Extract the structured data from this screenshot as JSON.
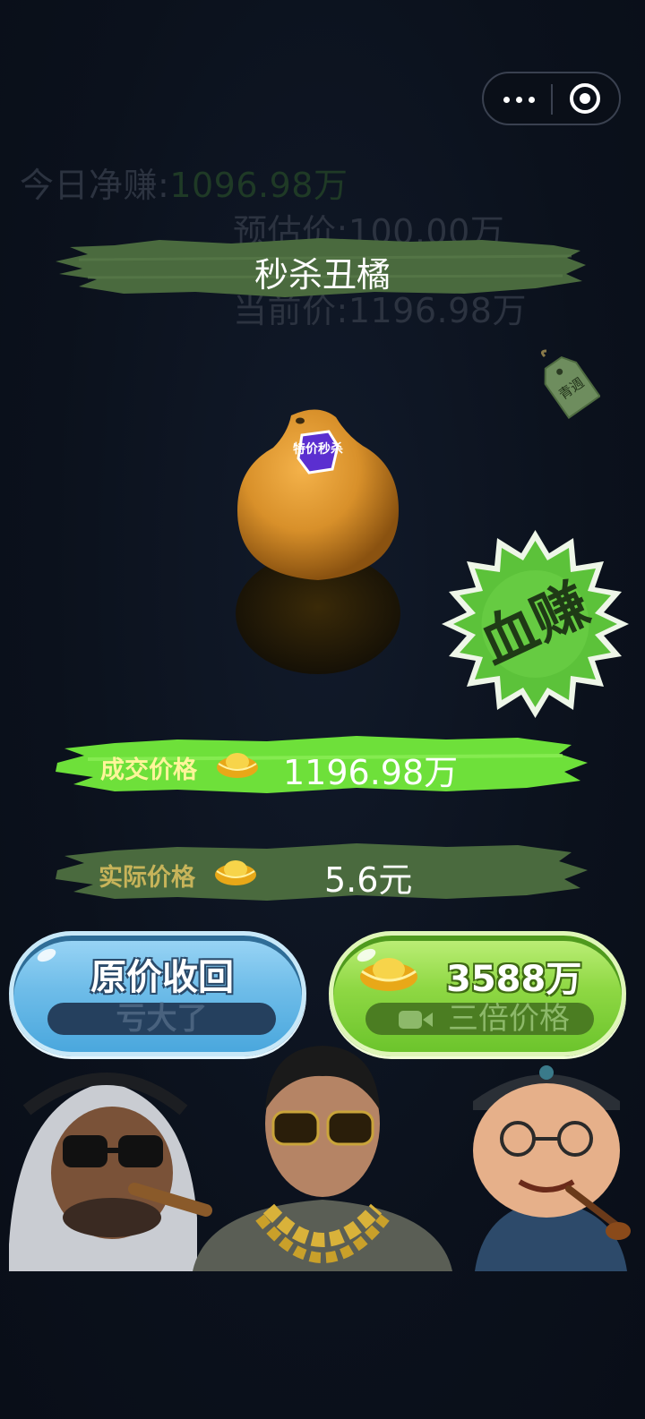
{
  "header": {
    "menu_icon": "more-dots-icon",
    "close_icon": "target-circle-icon"
  },
  "stats": {
    "today_net_label": "今日净赚:",
    "today_net_value": "1096.98万",
    "estimate_label": "预估价:",
    "estimate_value": "100.00万",
    "current_label": "当前价:",
    "current_value": "1196.98万"
  },
  "item": {
    "title": "秒杀丑橘",
    "sticker_text": "特价秒杀",
    "tag_text": "青週",
    "badge_text": "血赚"
  },
  "prices": {
    "deal_label": "成交价格",
    "deal_value": "1196.98万",
    "actual_label": "实际价格",
    "actual_value": "5.6元"
  },
  "buttons": {
    "recover_title": "原价收回",
    "recover_sub": "亏大了",
    "triple_amount": "3588万",
    "triple_sub": "三倍价格"
  },
  "colors": {
    "background": "#0d1320",
    "brush_dark_green": "#4a6a3e",
    "brush_bright_green": "#6ee03a",
    "badge_green": "#5cc23a",
    "gold": "#f2c230"
  }
}
